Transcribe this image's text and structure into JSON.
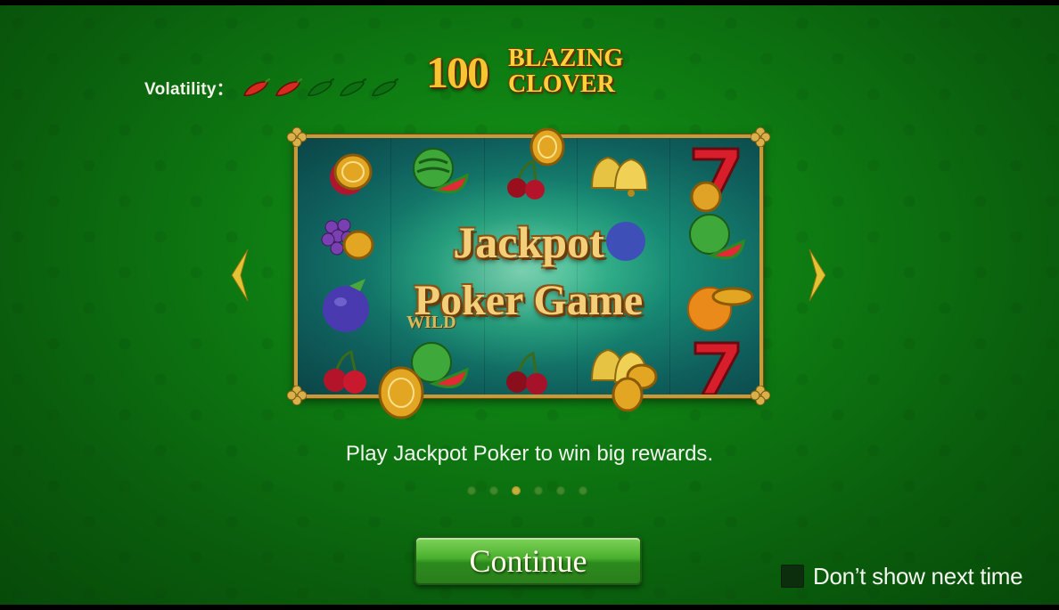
{
  "volatility": {
    "label": "Volatility：",
    "level": 2,
    "max": 5,
    "filled_color": "#d62a1e",
    "empty_color": "#0e6e12",
    "icon": "chili-pepper-icon"
  },
  "logo": {
    "number": "100",
    "line1": "BLAZING",
    "line2": "CLOVER"
  },
  "slide": {
    "headline_line1": "Jackpot",
    "headline_line2": "Poker Game",
    "wild_label": "WILD",
    "caption": "Play Jackpot Poker to win big rewards.",
    "current_index": 2,
    "total": 6,
    "symbols": [
      "coin-icon",
      "watermelon-icon",
      "cherry-icon",
      "bell-icon",
      "seven-icon",
      "grapes-icon",
      "plum-icon",
      "orange-icon"
    ]
  },
  "nav": {
    "prev_icon": "chevron-left-icon",
    "next_icon": "chevron-right-icon",
    "accent": "#e3c233"
  },
  "continue_button": {
    "label": "Continue"
  },
  "dont_show": {
    "label": "Don’t show next time",
    "checked": false
  }
}
